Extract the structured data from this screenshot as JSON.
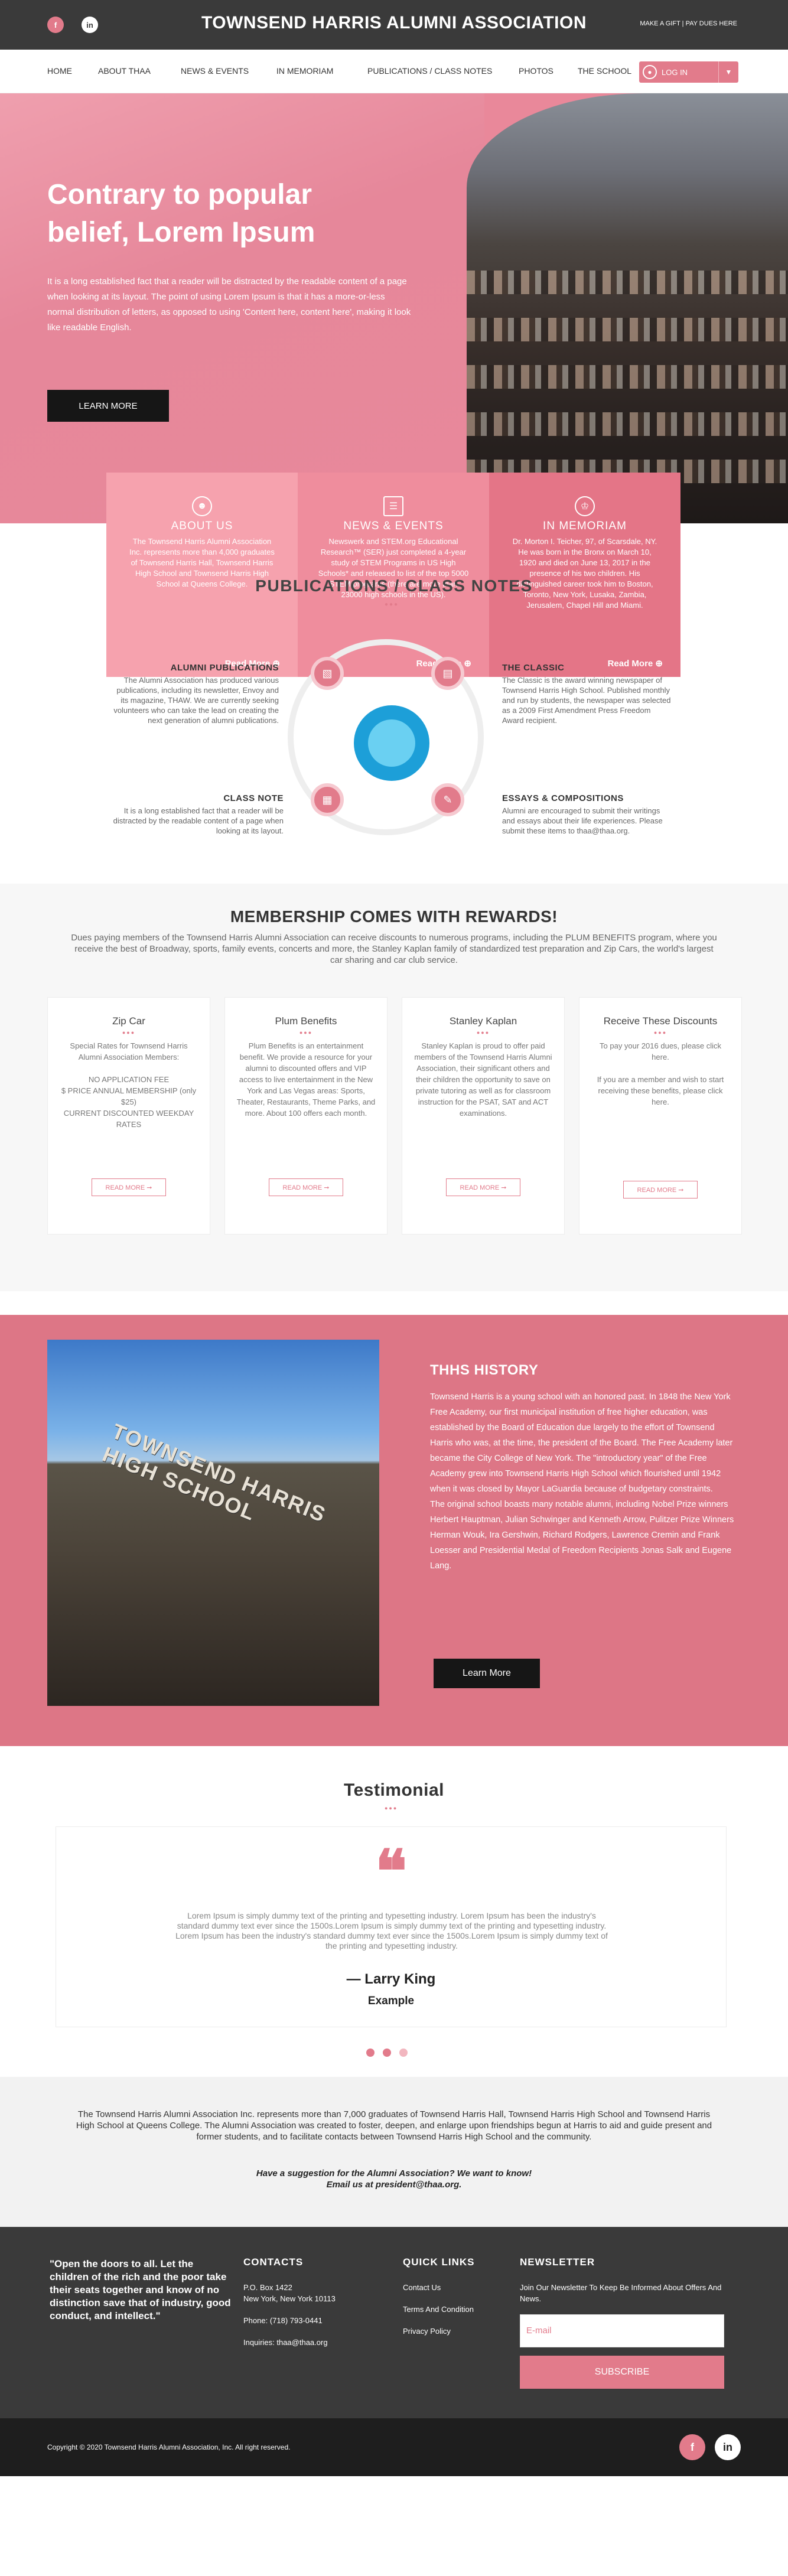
{
  "colors": {
    "accent": "#e27b8b",
    "dark": "#3a3a3a",
    "black": "#161616"
  },
  "topbar": {
    "title": "TOWNSEND HARRIS ALUMNI ASSOCIATION",
    "links": "MAKE A GIFT | PAY DUES HERE",
    "facebook": "f",
    "linkedin": "in"
  },
  "nav": {
    "items": [
      "HOME",
      "ABOUT THAA",
      "NEWS & EVENTS",
      "IN MEMORIAM",
      "PUBLICATIONS / CLASS NOTES",
      "PHOTOS",
      "THE SCHOOL"
    ],
    "login": "LOG IN"
  },
  "hero": {
    "title": "Contrary to popular belief, Lorem Ipsum",
    "body": "It is a long established fact that a reader will be distracted by the readable content of a page when looking at its layout. The point of using Lorem Ipsum is that it has a more-or-less normal distribution of letters, as opposed to using 'Content here, content here', making it look like readable English.",
    "button": "LEARN MORE"
  },
  "features": [
    {
      "title": "ABOUT US",
      "text": "The Townsend Harris Alumni Association Inc. represents more than 4,000 graduates of Townsend Harris Hall, Townsend Harris High School and Townsend Harris High School at Queens College.",
      "more": "Read More"
    },
    {
      "title": "NEWS &  EVENTS",
      "text": "Newswerk and STEM.org Educational Research™ (SER) just completed a 4-year study of STEM Programs in US High Schools* and released to list of the top 5000 STEM programs (there are more than 23000 high schools in the US).",
      "more": "Read More"
    },
    {
      "title": "IN MEMORIAM",
      "text": "Dr. Morton I. Teicher, 97, of Scarsdale, NY. He was born in the Bronx on March 10, 1920 and died on June 13, 2017 in the presence of his two children. His distinguished career took him to Boston, Toronto, New York, Lusaka, Zambia, Jerusalem, Chapel Hill and Miami.",
      "more": "Read More"
    }
  ],
  "pubs": {
    "title": "PUBLICATIONS / CLASS NOTES",
    "items": [
      {
        "title": "ALUMNI PUBLICATIONS",
        "text": "The Alumni Association has produced various publications, including its newsletter, Envoy and its magazine, THAW. We are currently seeking volunteers who can take the lead on creating the next generation of alumni publications."
      },
      {
        "title": "THE CLASSIC",
        "text": "The Classic is the award winning newspaper of Townsend Harris High School. Published monthly and run by students, the newspaper was selected as a 2009 First Amendment Press Freedom Award recipient."
      },
      {
        "title": "CLASS NOTE",
        "text": "It is a long established fact that a reader will be distracted by the readable content of a page when looking at its layout."
      },
      {
        "title": "ESSAYS & COMPOSITIONS",
        "text": "Alumni are encouraged to submit their writings and essays about their life experiences. Please submit these items to thaa@thaa.org."
      }
    ]
  },
  "membership": {
    "title": "MEMBERSHIP COMES WITH REWARDS!",
    "sub": "Dues paying members of the Townsend Harris Alumni Association can receive discounts to numerous programs, including the PLUM BENEFITS program, where you receive the best of Broadway, sports, family events, concerts and more, the Stanley Kaplan family of standardized test preparation and Zip Cars, the world's largest car sharing and car club service.",
    "cards": [
      {
        "title": "Zip Car",
        "text": "Special Rates for Townsend Harris Alumni Association Members:\n\nNO APPLICATION FEE\n$ PRICE ANNUAL MEMBERSHIP (only $25)\nCURRENT DISCOUNTED WEEKDAY RATES",
        "more": "READ MORE ➞"
      },
      {
        "title": "Plum Benefits",
        "text": "Plum Benefits is an entertainment benefit. We provide a resource for your alumni to discounted offers and VIP access to live entertainment in the New York and Las Vegas areas: Sports, Theater, Restaurants, Theme Parks, and more. About 100 offers each month.",
        "more": "READ MORE ➞"
      },
      {
        "title": "Stanley Kaplan",
        "text": "Stanley Kaplan is proud to offer paid members of the Townsend Harris Alumni Association, their significant others and their children the opportunity to save on private tutoring as well as for classroom instruction for the PSAT, SAT and ACT examinations.",
        "more": "READ MORE ➞"
      },
      {
        "title": "Receive These Discounts",
        "text": "To pay your 2016 dues, please click here.\n\nIf you are a member and wish to start receiving these benefits, please click here.",
        "more": "READ MORE ➞"
      }
    ]
  },
  "history": {
    "title": "THHS HISTORY",
    "text": "Townsend Harris is a young school with an honored past. In 1848 the New York Free Academy, our first municipal institution of free higher education, was established by the Board of Education due largely to the effort of Townsend Harris who was, at the time, the president of the Board. The Free Academy later became the City College of New York. The \"introductory year\" of the Free Academy grew into Townsend Harris High School which flourished until 1942 when it was closed by Mayor LaGuardia because of budgetary constraints.\nThe original school boasts many notable alumni, including Nobel Prize winners Herbert Hauptman, Julian Schwinger and Kenneth Arrow, Pulitzer Prize Winners Herman Wouk, Ira Gershwin, Richard Rodgers, Lawrence Cremin and Frank Loesser and Presidential Medal of Freedom Recipients Jonas Salk and Eugene Lang.",
    "button": "Learn More",
    "sign": "TOWNSEND HARRIS HIGH SCHOOL"
  },
  "testimonial": {
    "title": "Testimonial",
    "quote_mark": "❝",
    "text": "Lorem Ipsum is simply dummy text of the printing and typesetting industry. Lorem Ipsum has been the industry's standard dummy text ever since the 1500s.Lorem Ipsum is simply dummy text of the printing and typesetting industry. Lorem Ipsum has been the industry's standard dummy text ever since the 1500s.Lorem Ipsum is simply dummy text of the printing and typesetting industry.",
    "name": "— Larry King",
    "role": "Example"
  },
  "about": {
    "text": "The Townsend Harris Alumni Association Inc. represents more than 7,000 graduates of Townsend Harris Hall, Townsend Harris High School and Townsend Harris High School at Queens College. The Alumni Association was created to foster, deepen, and enlarge upon friendships begun at Harris to aid and guide present and former students, and to facilitate contacts between Townsend Harris High School and the community.",
    "ask": "Have a suggestion for the Alumni Association? We want to know!\nEmail us at president@thaa.org."
  },
  "footer": {
    "quote": "\"Open the doors to all. Let the children of the rich and the poor take their seats together and know of no distinction save that of industry, good conduct, and intellect.\"",
    "contacts_title": "CONTACTS",
    "address1": "P.O. Box 1422",
    "address2": "New York, New York 10113",
    "phone": "Phone: (718) 793-0441",
    "inquiries": "Inquiries: thaa@thaa.org",
    "quick_title": "QUICK LINKS",
    "quick": [
      "Contact Us",
      "Terms And Condition",
      "Privacy Policy"
    ],
    "news_title": "NEWSLETTER",
    "news_text": "Join Our Newsletter To Keep Be Informed About Offers And News.",
    "email_placeholder": "E-mail",
    "subscribe": "SUBSCRIBE",
    "copyright": "Copyright © 2020 Townsend Harris Alumni Association, Inc. All right reserved."
  }
}
